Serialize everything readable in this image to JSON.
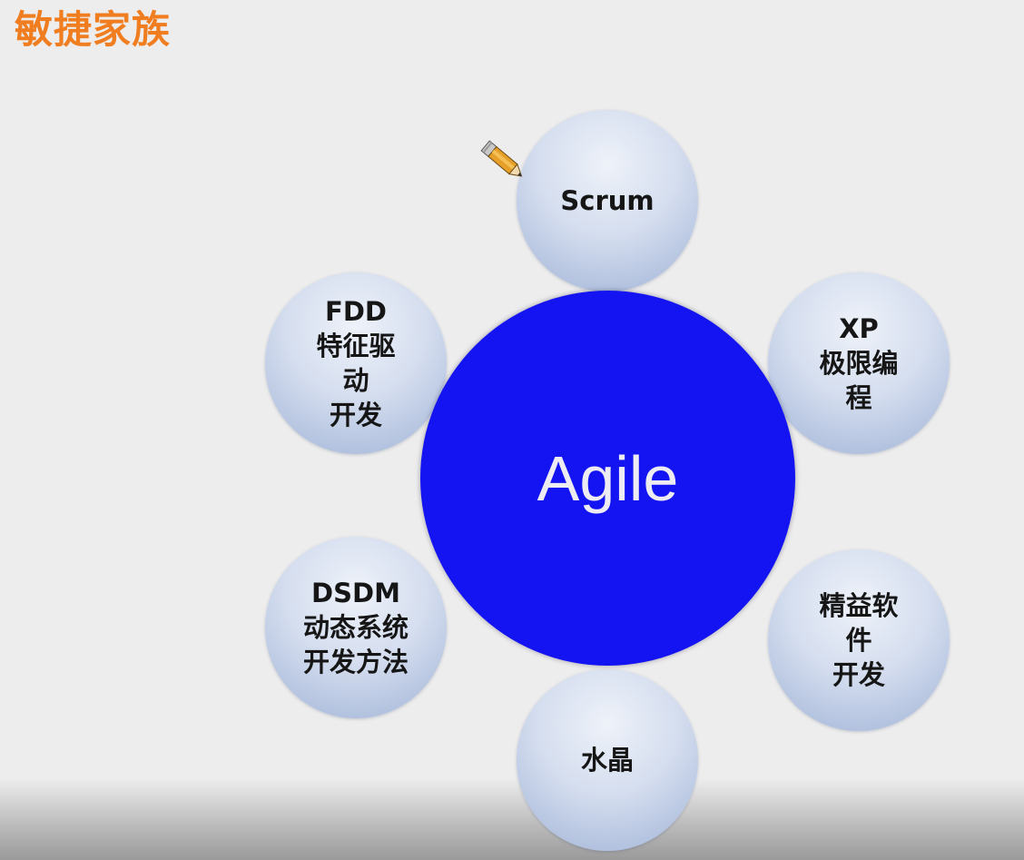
{
  "page": {
    "title": "敏捷家族",
    "title_color": "#f07d1f",
    "background": "#ededed"
  },
  "diagram": {
    "center": {
      "label": "Agile",
      "color": "#1414f2"
    },
    "nodes": {
      "scrum": {
        "lines": [
          "Scrum"
        ]
      },
      "fdd": {
        "lines": [
          "FDD",
          "特征驱",
          "动",
          "开发"
        ]
      },
      "xp": {
        "lines": [
          "XP",
          "极限编",
          "程"
        ]
      },
      "dsdm": {
        "lines": [
          "DSDM",
          "动态系统",
          "开发方法"
        ]
      },
      "lean": {
        "lines": [
          "精益软",
          "件",
          "开发"
        ]
      },
      "crystal": {
        "lines": [
          "水晶"
        ]
      }
    },
    "node_color": "#c6d3ea"
  },
  "icons": {
    "pointer": "pencil-icon"
  }
}
